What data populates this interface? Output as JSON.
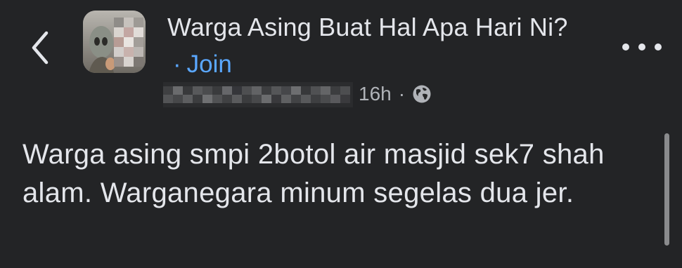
{
  "header": {
    "group_name": "Warga Asing Buat Hal Apa Hari Ni?",
    "join_separator": "·",
    "join_label": "Join",
    "back_icon": "chevron-left-icon",
    "more_icon": "more-horizontal-icon"
  },
  "post": {
    "time_ago": "16h",
    "meta_separator": "·",
    "privacy_icon": "globe-icon",
    "text": "Warga asing smpi 2botol air masjid sek7 shah alam. Warganegara minum segelas dua jer."
  },
  "colors": {
    "background": "#232426",
    "text_primary": "#e4e6eb",
    "text_secondary": "#b0b3b8",
    "link": "#5aa7ff"
  }
}
